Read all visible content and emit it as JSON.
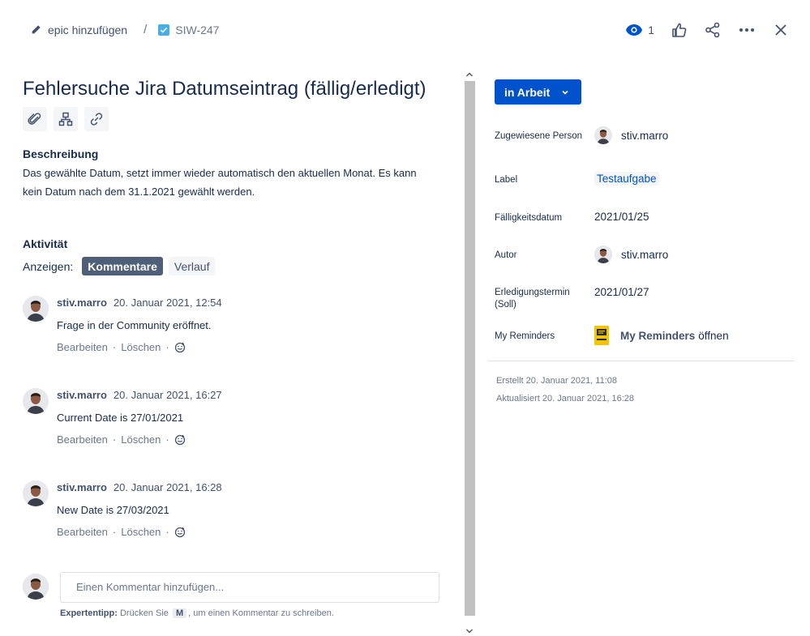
{
  "breadcrumb": {
    "epic_label": "epic hinzufügen",
    "separator": "/",
    "issue_key": "SIW-247"
  },
  "toolbar": {
    "watch_count": "1"
  },
  "issue": {
    "title": "Fehlersuche Jira Datumseintrag (fällig/erledigt)",
    "description_heading": "Beschreibung",
    "description": "Das gewählte Datum, setzt immer wieder automatisch den aktuellen Monat. Es kann kein Datum nach dem 31.1.2021 gewählt werden."
  },
  "activity": {
    "heading": "Aktivität",
    "show_label": "Anzeigen:",
    "tabs": [
      {
        "label": "Kommentare",
        "active": true
      },
      {
        "label": "Verlauf",
        "active": false
      }
    ]
  },
  "comments": [
    {
      "author": "stiv.marro",
      "date": "20. Januar 2021, 12:54",
      "text": "Frage in der Community eröffnet.",
      "edit": "Bearbeiten",
      "delete": "Löschen"
    },
    {
      "author": "stiv.marro",
      "date": "20. Januar 2021, 16:27",
      "text": "Current Date is 27/01/2021",
      "edit": "Bearbeiten",
      "delete": "Löschen"
    },
    {
      "author": "stiv.marro",
      "date": "20. Januar 2021, 16:28",
      "text": "New Date is 27/03/2021",
      "edit": "Bearbeiten",
      "delete": "Löschen"
    }
  ],
  "add_comment": {
    "placeholder": "Einen Kommentar hinzufügen...",
    "tip_bold": "Expertentipp:",
    "tip_pre": "Drücken Sie",
    "tip_key": "M",
    "tip_post": ", um einen Kommentar zu schreiben."
  },
  "sidebar": {
    "status": "in Arbeit",
    "fields": {
      "assignee": {
        "label": "Zugewiesene Person",
        "value": "stiv.marro"
      },
      "labels": {
        "label": "Label",
        "value": "Testaufgabe"
      },
      "due_date": {
        "label": "Fälligkeitsdatum",
        "value": "2021/01/25"
      },
      "reporter": {
        "label": "Autor",
        "value": "stiv.marro"
      },
      "target_date": {
        "label": "Erledigungstermin (Soll)",
        "value": "2021/01/27"
      },
      "reminders": {
        "label": "My Reminders",
        "link": "My Reminders",
        "suffix": "öffnen"
      }
    },
    "created": "Erstellt 20. Januar 2021, 11:08",
    "updated": "Aktualisiert 20. Januar 2021, 16:28"
  },
  "colors": {
    "primary": "#0052cc",
    "text": "#172b4d",
    "subtle": "#6b778c",
    "active_tab": "#505f79",
    "issue_type": "#4bade8",
    "reminder_icon": "#f5c400"
  }
}
